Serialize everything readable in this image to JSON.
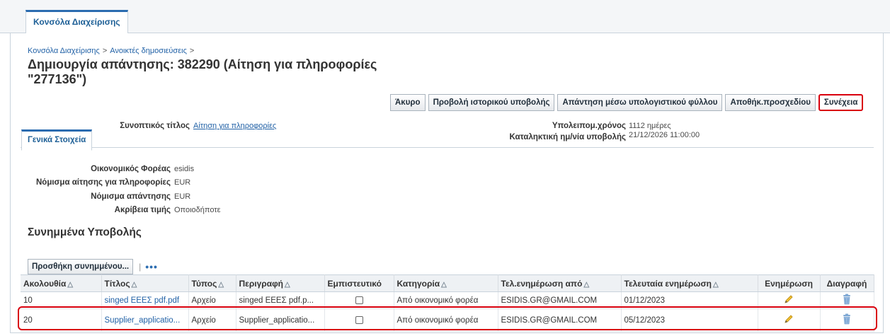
{
  "top_tab": "Κονσόλα Διαχείρισης",
  "breadcrumb": {
    "item1": "Κονσόλα Διαχείρισης",
    "item2": "Ανοικτές δημοσιεύσεις",
    "separator": ">"
  },
  "page_title": "Δημιουργία απάντησης: 382290 (Αίτηση για πληροφορίες \"277136\")",
  "buttons": {
    "cancel": "Άκυρο",
    "history": "Προβολή ιστορικού υποβολής",
    "spreadsheet": "Απάντηση μέσω υπολογιστικού φύλλου",
    "save_draft": "Αποθήκ.προσχεδίου",
    "continue": "Συνέχεια"
  },
  "summary": {
    "short_title_label": "Συνοπτικός τίτλος",
    "short_title_value": "Αίτηση για πληροφορίες",
    "time_left_label": "Υπολειπομ.χρόνος",
    "time_left_value": "1112 ημέρες",
    "deadline_label": "Καταληκτική ημ/νία υποβολής",
    "deadline_value": "21/12/2026 11:00:00"
  },
  "inner_tab": "Γενικά Στοιχεία",
  "general": {
    "supplier_label": "Οικονομικός Φορέας",
    "supplier_value": "esidis",
    "rfi_currency_label": "Νόμισμα αίτησης για πληροφορίες",
    "rfi_currency_value": "EUR",
    "resp_currency_label": "Νόμισμα απάντησης",
    "resp_currency_value": "EUR",
    "precision_label": "Ακρίβεια τιμής",
    "precision_value": "Οποιοδήποτε"
  },
  "attachments": {
    "title": "Συνημμένα Υποβολής",
    "add_button": "Προσθήκη συνημμένου...",
    "more": "•••",
    "columns": [
      "Ακολουθία",
      "Τίτλος",
      "Τύπος",
      "Περιγραφή",
      "Εμπιστευτικό",
      "Κατηγορία",
      "Τελ.ενημέρωση από",
      "Τελευταία ενημέρωση",
      "Ενημέρωση",
      "Διαγραφή"
    ],
    "rows": [
      {
        "seq": "10",
        "title": "singed ΕΕΕΣ pdf.pdf",
        "type": "Αρχείο",
        "description": "singed ΕΕΕΣ pdf.p...",
        "category": "Από οικονομικό φορέα",
        "updated_by": "ESIDIS.GR@GMAIL.COM",
        "updated": "01/12/2023"
      },
      {
        "seq": "20",
        "title": "Supplier_applicatio...",
        "type": "Αρχείο",
        "description": "Supplier_applicatio...",
        "category": "Από οικονομικό φορέα",
        "updated_by": "ESIDIS.GR@GMAIL.COM",
        "updated": "05/12/2023"
      }
    ]
  },
  "colors": {
    "accent": "#2b6cb0",
    "highlight": "#d9000d",
    "link": "#2161a6"
  }
}
